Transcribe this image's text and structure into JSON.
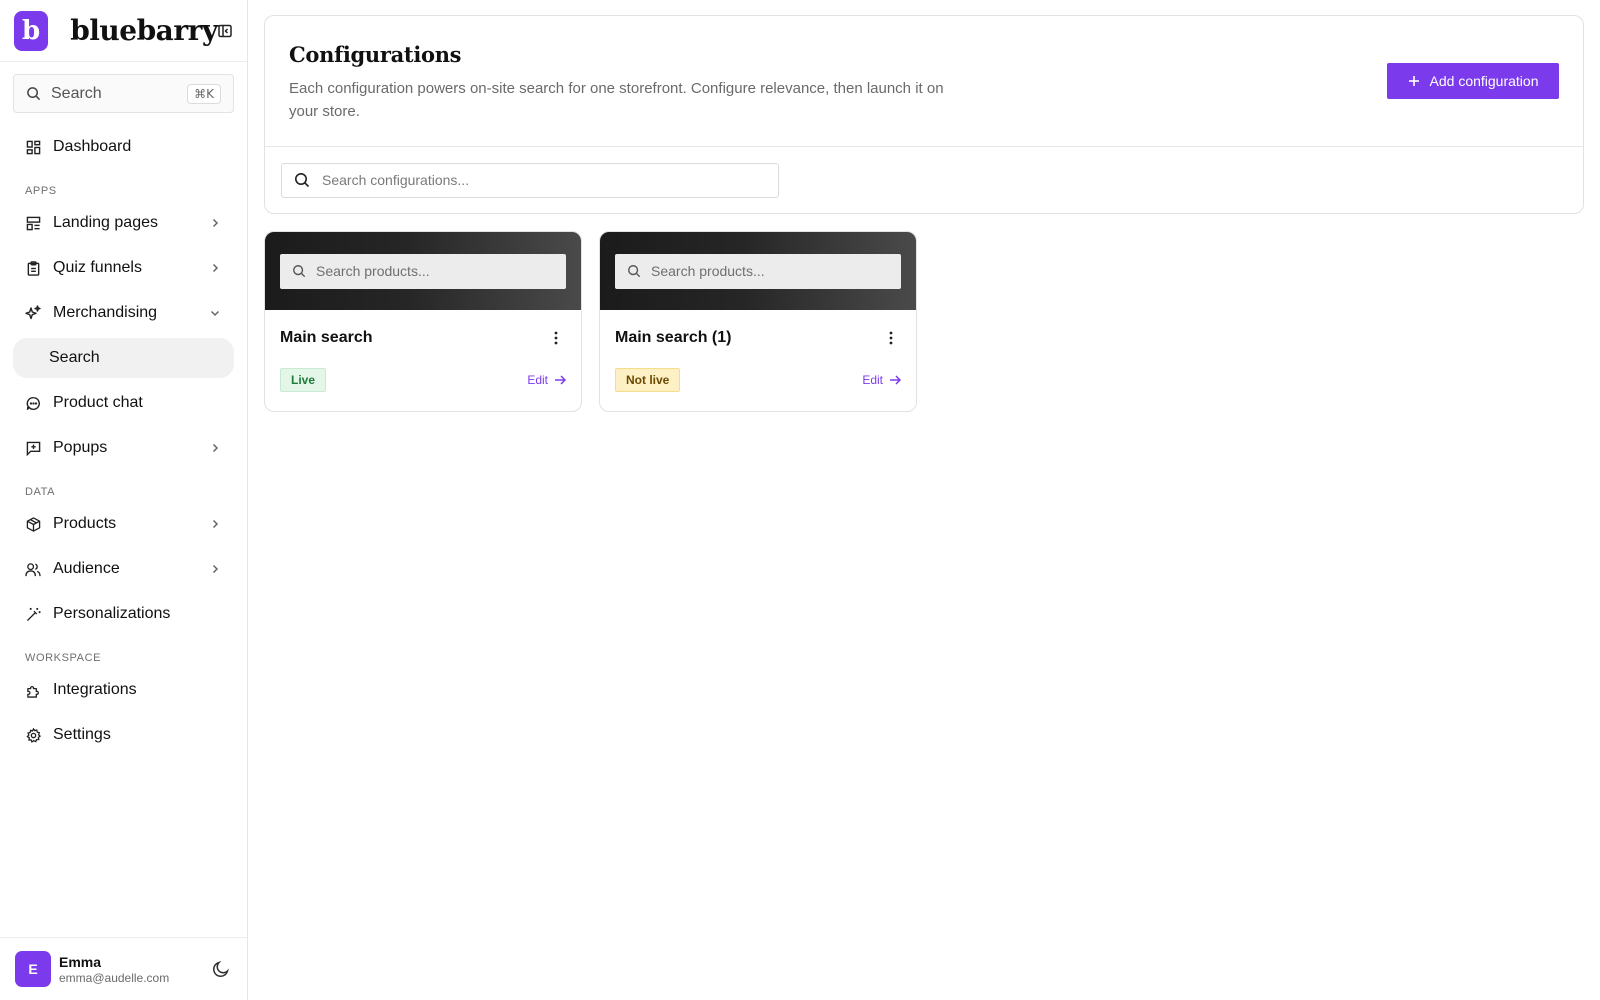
{
  "brand": {
    "letter": "b",
    "name": "bluebarry"
  },
  "sidebar": {
    "search": {
      "label": "Search",
      "shortcut": "⌘K"
    },
    "dashboard": {
      "label": "Dashboard",
      "icon": "dashboard-icon"
    },
    "sections": {
      "apps": "APPS",
      "data": "DATA",
      "workspace": "WORKSPACE"
    },
    "items": {
      "landing_pages": "Landing pages",
      "quiz_funnels": "Quiz funnels",
      "merchandising": "Merchandising",
      "search": "Search",
      "product_chat": "Product chat",
      "popups": "Popups",
      "products": "Products",
      "audience": "Audience",
      "personalizations": "Personalizations",
      "integrations": "Integrations",
      "settings": "Settings"
    },
    "active_item": "Search"
  },
  "user": {
    "initial": "E",
    "name": "Emma",
    "email": "emma@audelle.com"
  },
  "main": {
    "title": "Configurations",
    "description": "Each configuration powers on-site search for one storefront. Configure relevance, then launch it on your store.",
    "add_button": "Add configuration",
    "search_placeholder": "Search configurations..."
  },
  "cards": [
    {
      "preview_placeholder": "Search products...",
      "title": "Main search",
      "status": "Live",
      "edit": "Edit"
    },
    {
      "preview_placeholder": "Search products...",
      "title": "Main search (1)",
      "status": "Not live",
      "edit": "Edit"
    }
  ],
  "colors": {
    "accent": "#7c3aed",
    "live_bg": "#e3f6e8",
    "live_text": "#1f7a3a",
    "notlive_bg": "#fdf0c4",
    "notlive_text": "#6b4a00"
  }
}
